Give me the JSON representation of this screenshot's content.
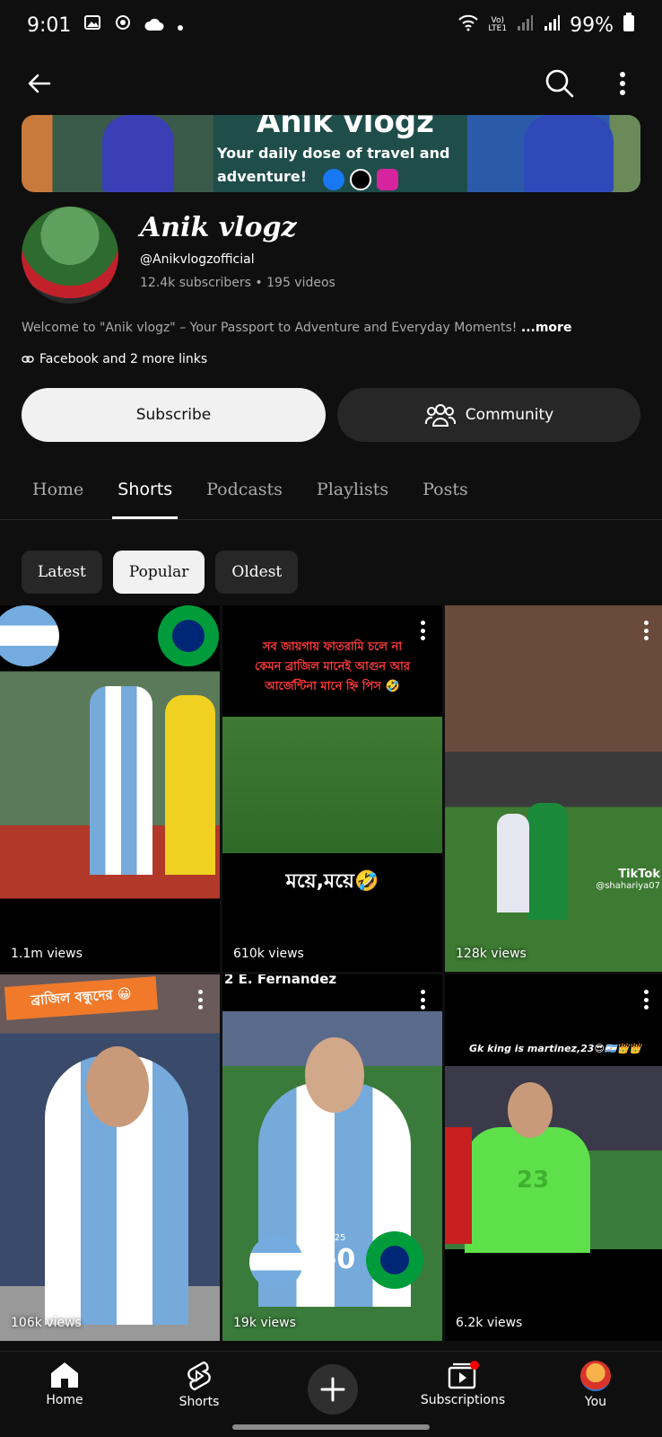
{
  "status_bar": {
    "time": "9:01",
    "network_label_top": "Vo)",
    "network_label_bottom": "LTE1",
    "battery": "99%"
  },
  "banner": {
    "title": "Anik vlogz",
    "tagline_line1": "Your daily dose of travel and",
    "tagline_line2": "adventure!"
  },
  "channel": {
    "name": "Anik vlogz",
    "handle": "@Anikvlogzofficial",
    "stats": "12.4k subscribers • 195 videos",
    "description": "Welcome to \"Anik vlogz\" – Your Passport to Adventure and Everyday Moments! ",
    "description_more": "...more",
    "links": "Facebook and 2 more links"
  },
  "buttons": {
    "subscribe": "Subscribe",
    "community": "Community"
  },
  "tabs": [
    "Home",
    "Shorts",
    "Podcasts",
    "Playlists",
    "Posts"
  ],
  "active_tab": "Shorts",
  "chips": [
    "Latest",
    "Popular",
    "Oldest"
  ],
  "selected_chip": "Popular",
  "shorts": [
    {
      "views": "1.1m views"
    },
    {
      "views": "610k views",
      "top_text": "সব জায়গায় ফাতরামি চলে না কেমন ব্রাজিল মানেই আগুন আর আর্জেন্টিনা মানে হ্নি পিস 🤣",
      "mid_text": "ময়ে,ময়ে🤣"
    },
    {
      "views": "128k views",
      "watermark": "TikTok",
      "watermark_user": "@shahariya07"
    },
    {
      "views": "106k views",
      "top_text": "ব্রাজিল বন্ধুদের 😀"
    },
    {
      "views": "19k views",
      "top_text": "2  E. Fernandez",
      "score": "2-0",
      "year": "2025"
    },
    {
      "views": "6.2k views",
      "top_text": "Gk king is martinez,23😎🇦🇷👑👑",
      "jersey": "23"
    }
  ],
  "nav": {
    "home": "Home",
    "shorts": "Shorts",
    "subscriptions": "Subscriptions",
    "you": "You"
  },
  "colors": {
    "background": "#0f0f0f",
    "chip_selected": "#f1f1f1",
    "button_dark": "#272727",
    "notification_dot": "#ff0000"
  }
}
